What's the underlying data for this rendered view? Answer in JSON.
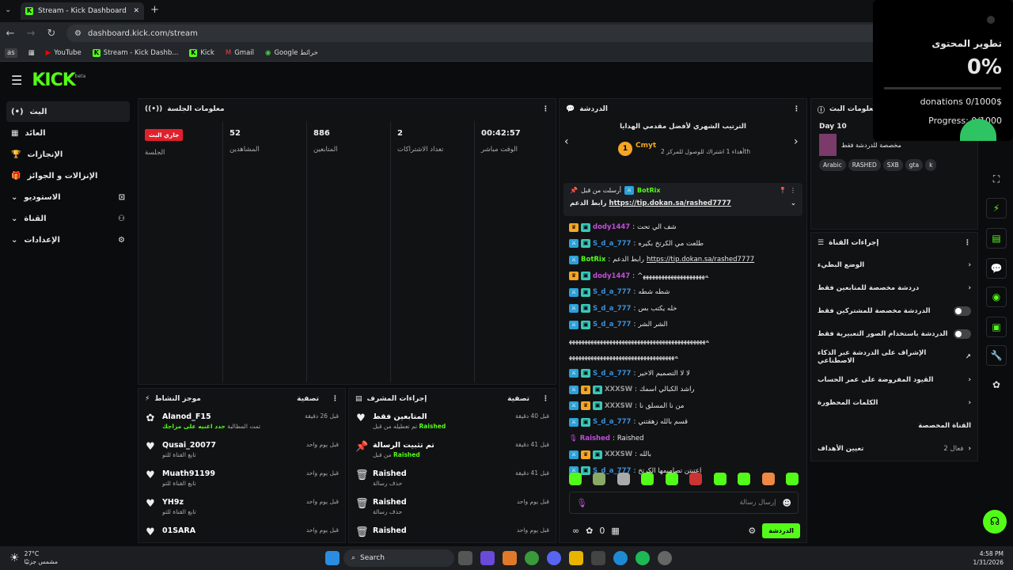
{
  "browser": {
    "tab_title": "Stream - Kick Dashboard",
    "url": "dashboard.kick.com/stream",
    "bookmarks": [
      "YouTube",
      "Stream - Kick Dashb...",
      "Kick",
      "Gmail",
      "Google خرائط"
    ],
    "profile": "as"
  },
  "app": {
    "logo": "KICK",
    "logo_sup": "beta"
  },
  "sidebar": {
    "items": [
      {
        "label": "البث",
        "icon": "(•)"
      },
      {
        "label": "العائد",
        "icon": "▦"
      },
      {
        "label": "الإنجازات",
        "icon": "🏆"
      },
      {
        "label": "الإنزالات و الجوائز",
        "icon": "🎁"
      },
      {
        "label": "الاستوديو",
        "icon": "⌄"
      },
      {
        "label": "القناة",
        "icon": "⌄"
      },
      {
        "label": "الإعدادات",
        "icon": "⌄"
      }
    ]
  },
  "session": {
    "title": "معلومات الجلسة",
    "live_badge": "جاري البث",
    "session_label": "الجلسة",
    "stats": [
      {
        "value": "52",
        "label": "المشاهدين"
      },
      {
        "value": "886",
        "label": "المتابعين"
      },
      {
        "value": "2",
        "label": "تعداد الاشتراكات"
      },
      {
        "value": "00:42:57",
        "label": "الوقت مباشر"
      }
    ]
  },
  "activity": {
    "title": "موجز النشاط",
    "filter": "تصفية",
    "items": [
      {
        "name": "Alanod_F15",
        "sub_prefix": "تمت المطالبة",
        "sub_hl": "حدد اغنيه على مزاجك",
        "time": "قبل 26 دقيقة",
        "icon": "✿"
      },
      {
        "name": "Qusai_20077",
        "sub": "تابع القناة للتو",
        "time": "قبل يوم واحد",
        "icon": "♥"
      },
      {
        "name": "Muath91199",
        "sub": "تابع القناة للتو",
        "time": "قبل يوم واحد",
        "icon": "♥"
      },
      {
        "name": "YH9z",
        "sub": "تابع القناة للتو",
        "time": "قبل يوم واحد",
        "icon": "♥"
      },
      {
        "name": "01SARA",
        "sub": "",
        "time": "قبل يوم واحد",
        "icon": "♥"
      }
    ]
  },
  "modactions": {
    "title": "إجراءات المشرف",
    "filter": "تصفية",
    "items": [
      {
        "name": "المتابعين فقط",
        "sub_prefix": "تم تعطيله من قبل",
        "sub_hl": "Raished",
        "time": "قبل 40 دقيقة",
        "icon": "♥"
      },
      {
        "name": "تم تثبيت الرسالة",
        "sub_prefix": "من قبل",
        "sub_hl": "Raished",
        "time": "قبل 41 دقيقة",
        "icon": "📌"
      },
      {
        "name": "Raished",
        "sub": "حذف رسالة",
        "time": "قبل 41 دقيقة",
        "icon": "🗑"
      },
      {
        "name": "Raished",
        "sub": "حذف رسالة",
        "time": "قبل يوم واحد",
        "icon": "🗑"
      },
      {
        "name": "Raished",
        "sub": "",
        "time": "قبل يوم واحد",
        "icon": "🗑"
      }
    ]
  },
  "chat": {
    "title": "الدردشة",
    "leaderboard_title": "الترتيب الشهري لأفضل مقدمي الهدايا",
    "leader_rank": "1",
    "leader_name": "Cmyt",
    "leader_note": "أهداء 1 اشتراك للوصول للمركز 2",
    "leader_note_suffix": "th",
    "pinned": {
      "by": "أرسلت من قبل",
      "user": "BotRix",
      "text": "رابط الدعم",
      "link": "https://tip.dokan.sa/rashed7777"
    },
    "messages": [
      {
        "user": "dody1447",
        "color": "#c04fd8",
        "text": "شف الي تحت",
        "b": [
          "crown",
          "sub"
        ]
      },
      {
        "user": "S_d_a_777",
        "color": "#3a8fd8",
        "text": "طلعت مي الكرتخ بكيره",
        "b": [
          "mod",
          "sub"
        ]
      },
      {
        "user": "BotRix",
        "color": "#53fc18",
        "text": "رابط الدعم",
        "link": "https://tip.dokan.sa/rashed7777",
        "b": [
          "mod"
        ]
      },
      {
        "user": "dody1447",
        "color": "#c04fd8",
        "text": "^ﻪﻬﻬﻬﻬﻬﻬﻬﻬﻬﻬﻬﻬﻬﻬﻬﻬﻬﻬﻬﻬ",
        "b": [
          "crown",
          "sub"
        ]
      },
      {
        "user": "S_d_a_777",
        "color": "#3a8fd8",
        "text": "شطه شطه",
        "b": [
          "mod",
          "sub"
        ]
      },
      {
        "user": "S_d_a_777",
        "color": "#3a8fd8",
        "text": "خله يكتب بس",
        "b": [
          "mod",
          "sub"
        ]
      },
      {
        "user": "S_d_a_777",
        "color": "#3a8fd8",
        "text": "الشر الشر",
        "b": [
          "mod",
          "sub"
        ]
      },
      {
        "user": "",
        "color": "#fff",
        "text": "ﻪﻬﻬﻬﻬﻬﻬﻬﻬﻬﻬﻬﻬﻬﻬﻬﻬﻬﻬﻬﻬﻬﻬﻬﻬﻬﻬﻬﻬﻬﻬﻬﻬﻬﻬﻬﻬﻬﻬﻬﻬﻬﻬﻬﻬ",
        "b": []
      },
      {
        "user": "",
        "color": "#fff",
        "text": "ﻪﻬﻬﻬﻬﻬﻬﻬﻬﻬﻬﻬﻬﻬﻬﻬﻬﻬﻬﻬﻬﻬﻬﻬﻬﻬﻬﻬﻬﻬﻬﻬﻬﻬﻬ",
        "b": []
      },
      {
        "user": "S_d_a_777",
        "color": "#3a8fd8",
        "text": "لا لا التصميم الاخير",
        "b": [
          "mod",
          "sub"
        ]
      },
      {
        "user": "XXXSW",
        "color": "#9a9a9a",
        "text": "راشد الكبالي اسمك",
        "b": [
          "mod",
          "crown",
          "sub"
        ]
      },
      {
        "user": "XXXSW",
        "color": "#9a9a9a",
        "text": "من نا المسلق نا",
        "b": [
          "mod",
          "crown",
          "sub"
        ]
      },
      {
        "user": "S_d_a_777",
        "color": "#3a8fd8",
        "text": "قسم بالله زهقتني",
        "b": [
          "mod",
          "sub"
        ]
      },
      {
        "user": "Raished",
        "color": "#c04fd8",
        "text": "Raished",
        "b": [
          "mic"
        ]
      },
      {
        "user": "XXXSW",
        "color": "#9a9a9a",
        "text": "بالله",
        "b": [
          "mod",
          "crown",
          "sub"
        ]
      },
      {
        "user": "S_d_a_777",
        "color": "#3a8fd8",
        "text": "اعتبتن تصاميمها الكرتخ",
        "b": [
          "mod",
          "sub"
        ]
      }
    ],
    "input_placeholder": "إرسال رسالة",
    "count": "0",
    "send_label": "الدردشة"
  },
  "streaminfo": {
    "title": "معلومات البث",
    "day": "Day 10",
    "category": "مخصصة للدردشة فقط",
    "tags": [
      "Arabic",
      "RASHED",
      "SXB",
      "gta",
      "k"
    ]
  },
  "channel_actions": {
    "title": "إجراءات القناة",
    "items": [
      {
        "label": "الوضع البطيء",
        "ctl": "arrow"
      },
      {
        "label": "دردشة مخصصة للمتابعين فقط",
        "ctl": "arrow"
      },
      {
        "label": "الدردشة مخصصة للمشتركين فقط",
        "ctl": "toggle"
      },
      {
        "label": "الدردشة باستخدام الصور التعبيرية فقط",
        "ctl": "toggle"
      },
      {
        "label": "الإشراف على الدردشة عبر الذكاء الاصطناعي",
        "ctl": "ext"
      },
      {
        "label": "القيود المفروضة على عمر الحساب",
        "ctl": "arrow"
      },
      {
        "label": "الكلمات المحظورة",
        "ctl": "arrow"
      }
    ],
    "custom_title": "القناة المخصصة",
    "goal_label": "تعيين الأهداف",
    "goal_status": "فعال 2"
  },
  "overlay": {
    "title": "تطوير المحتوى",
    "percent": "0%",
    "donations": "donations 0/1000$",
    "progress": "Progress: 0/1000",
    "progress_fraction": 0
  },
  "taskbar": {
    "weather_temp": "27°C",
    "weather_desc": "مشمس جزئيًا",
    "search": "Search",
    "time": "4:58 PM",
    "date": "1/31/2026"
  }
}
